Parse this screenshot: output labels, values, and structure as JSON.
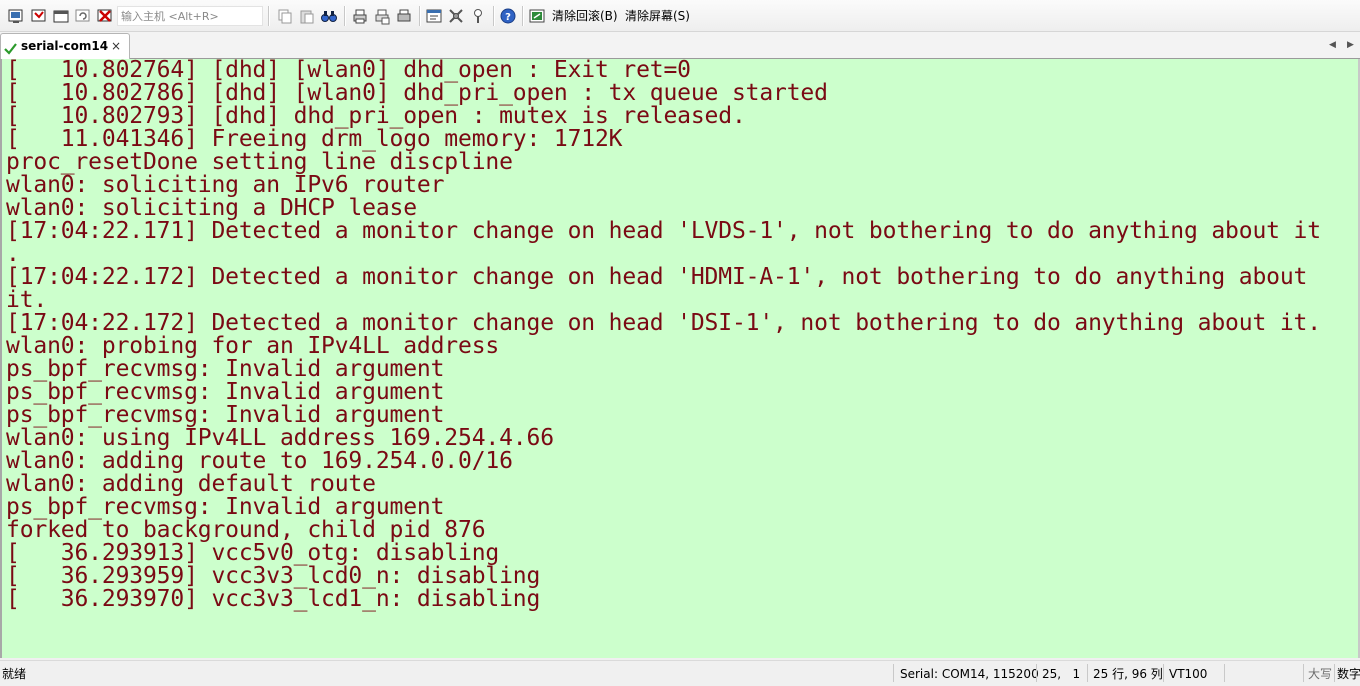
{
  "toolbar": {
    "host_placeholder": "输入主机 <Alt+R>",
    "clear_scrollback_label": "清除回滚(B)",
    "clear_screen_label": "清除屏幕(S)"
  },
  "tabs": [
    {
      "label": "serial-com14",
      "close": "×",
      "active": true
    }
  ],
  "tab_scroll": {
    "left": "◀",
    "right": "▶"
  },
  "terminal": {
    "text_color": "#7a0a14",
    "background": "#ccffcc",
    "lines": [
      "[   10.802764] [dhd] [wlan0] dhd_open : Exit ret=0",
      "[   10.802786] [dhd] [wlan0] dhd_pri_open : tx queue started",
      "[   10.802793] [dhd] dhd_pri_open : mutex is released.",
      "[   11.041346] Freeing drm_logo memory: 1712K",
      "proc_resetDone setting line discpline",
      "wlan0: soliciting an IPv6 router",
      "wlan0: soliciting a DHCP lease",
      "[17:04:22.171] Detected a monitor change on head 'LVDS-1', not bothering to do anything about it",
      ".",
      "[17:04:22.172] Detected a monitor change on head 'HDMI-A-1', not bothering to do anything about",
      "it.",
      "[17:04:22.172] Detected a monitor change on head 'DSI-1', not bothering to do anything about it.",
      "wlan0: probing for an IPv4LL address",
      "ps_bpf_recvmsg: Invalid argument",
      "ps_bpf_recvmsg: Invalid argument",
      "ps_bpf_recvmsg: Invalid argument",
      "wlan0: using IPv4LL address 169.254.4.66",
      "wlan0: adding route to 169.254.0.0/16",
      "wlan0: adding default route",
      "ps_bpf_recvmsg: Invalid argument",
      "forked to background, child pid 876",
      "[   36.293913] vcc5v0_otg: disabling",
      "[   36.293959] vcc3v3_lcd0_n: disabling",
      "[   36.293970] vcc3v3_lcd1_n: disabling"
    ]
  },
  "statusbar": {
    "ready": "就绪",
    "serial": "Serial: COM14, 115200",
    "cursor_pos": "25,   1",
    "rows_cols": "25 行, 96 列",
    "emulation": "VT100",
    "caps": "大写",
    "num": "数字"
  },
  "icons": [
    "connect-icon",
    "quick-connect-icon",
    "connect-tab-icon",
    "reconnect-icon",
    "disconnect-icon",
    "copy-icon",
    "paste-icon",
    "find-icon",
    "print-icon",
    "print-setup-icon",
    "printer-icon",
    "session-options-icon",
    "global-options-icon",
    "keymap-icon",
    "help-icon",
    "clear-icon"
  ]
}
